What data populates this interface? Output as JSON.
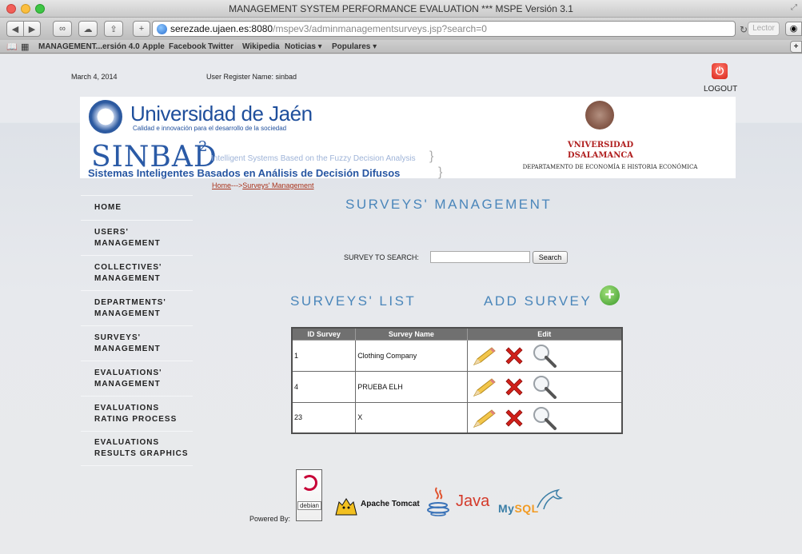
{
  "browser": {
    "window_title": "MANAGEMENT SYSTEM PERFORMANCE EVALUATION *** MSPE Versión 3.1",
    "url_host": "serezade.ujaen.es:8080",
    "url_path": "/mspev3/adminmanagementsurveys.jsp?search=0",
    "reader_label": "Lector",
    "bookmarks": [
      "MANAGEMENT...ersión 4.0",
      "Apple",
      "Facebook",
      "Twitter",
      "Wikipedia",
      "Noticias ▾",
      "Populares ▾"
    ]
  },
  "header": {
    "date": "March 4, 2014",
    "user_register": "User Register Name: sinbad",
    "logout_label": "LOGOUT"
  },
  "banner": {
    "uja_title": "Universidad de Jaén",
    "uja_subtitle": "Calidad e innovación para el desarrollo de la sociedad",
    "sinbad_word": "SINBAD",
    "sinbad_sup": "2",
    "sinbad_en": "Intelligent Systems Based on the Fuzzy Decision Analysis",
    "sinbad_es": "Sistemas Inteligentes Basados en Análisis de Decisión Difusos",
    "usal_name1": "VNIVERSIDAD",
    "usal_name2": "DSALAMANCA",
    "usal_dept": "DEPARTAMENTO DE ECONOMÍA E HISTORIA ECONÓMICA"
  },
  "breadcrumb": {
    "home": "Home",
    "separator": "--->",
    "current": "Surveys' Management"
  },
  "sidebar": {
    "items": [
      {
        "label": "HOME"
      },
      {
        "label": "USERS' MANAGEMENT"
      },
      {
        "label": "COLLECTIVES' MANAGEMENT"
      },
      {
        "label": "DEPARTMENTS' MANAGEMENT"
      },
      {
        "label": "SURVEYS' MANAGEMENT"
      },
      {
        "label": "EVALUATIONS' MANAGEMENT"
      },
      {
        "label": "EVALUATIONS RATING PROCESS"
      },
      {
        "label": "EVALUATIONS RESULTS GRAPHICS"
      }
    ]
  },
  "main": {
    "title": "SURVEYS' MANAGEMENT",
    "search_label": "SURVEY TO SEARCH:",
    "search_value": "",
    "search_button": "Search",
    "list_title": "SURVEYS' LIST",
    "add_survey": "ADD SURVEY"
  },
  "table": {
    "headers": [
      "ID Survey",
      "Survey Name",
      "Edit"
    ],
    "rows": [
      {
        "id": "1",
        "name": "Clothing Company"
      },
      {
        "id": "4",
        "name": "PRUEBA ELH"
      },
      {
        "id": "23",
        "name": "X"
      }
    ]
  },
  "footer": {
    "powered_by": "Powered By:",
    "debian": "debian",
    "tomcat": "Apache Tomcat",
    "java": "Java",
    "mysql_a": "My",
    "mysql_b": "SQL"
  },
  "colors": {
    "accent_title": "#4a86ba",
    "breadcrumb": "#a8321b",
    "table_header": "#707070"
  }
}
